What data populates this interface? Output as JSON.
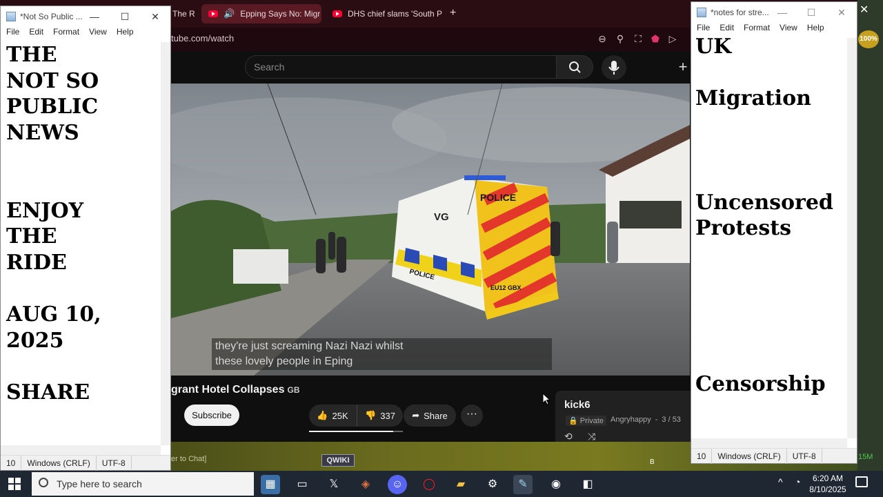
{
  "browser": {
    "tabs": [
      {
        "label": "The R"
      },
      {
        "label": "Epping Says No: Migr"
      },
      {
        "label": "DHS chief slams 'South P"
      }
    ],
    "new_tab": "+",
    "url": "tube.com/watch"
  },
  "youtube": {
    "search_placeholder": "Search",
    "caption_line1": "they're just screaming Nazi Nazi whilst",
    "caption_line2": "these lovely people in Eping",
    "video_title": "grant Hotel Collapses",
    "title_flag": "GB",
    "subscribe": "Subscribe",
    "likes": "25K",
    "dislikes": "337",
    "share": "Share",
    "more": "···",
    "like_ratio": 0.9,
    "van_label": "POLICE",
    "van_side": "POLICE",
    "van_code": "VG",
    "van_plate": "EU12 GBX"
  },
  "playlist": {
    "title": "kick6",
    "privacy": "Private",
    "owner": "Angryhappy",
    "position": "3 / 53"
  },
  "notepad_left": {
    "title": "*Not So Public ...",
    "menu": [
      "File",
      "Edit",
      "Format",
      "View",
      "Help"
    ],
    "content": "THE\nNOT SO\nPUBLIC\nNEWS\n\n\nENJOY\nTHE\nRIDE\n\nAUG 10,\n2025\n\nSHARE",
    "status_pos": "10",
    "status_eol": "Windows (CRLF)",
    "status_enc": "UTF-8"
  },
  "notepad_right": {
    "title": "*notes for stre...",
    "menu": [
      "File",
      "Edit",
      "Format",
      "View",
      "Help"
    ],
    "content": "UK\n\nMigration\n\n\n\nUncensored\nProtests\n\n\n\n\n\nCensorship",
    "status_pos": "10",
    "status_eol": "Windows (CRLF)",
    "status_enc": "UTF-8"
  },
  "game": {
    "chat_hint": "er to Chat]",
    "qwiki": "QWIKI",
    "zoom": "100%",
    "counter": "15M",
    "marker": "B"
  },
  "taskbar": {
    "search_placeholder": "Type here to search",
    "time": "6:20 AM",
    "date": "8/10/2025"
  },
  "colors": {
    "tab_bg": "#2a0d12",
    "accent_red": "#ff0033",
    "taskbar": "#1f2733"
  }
}
